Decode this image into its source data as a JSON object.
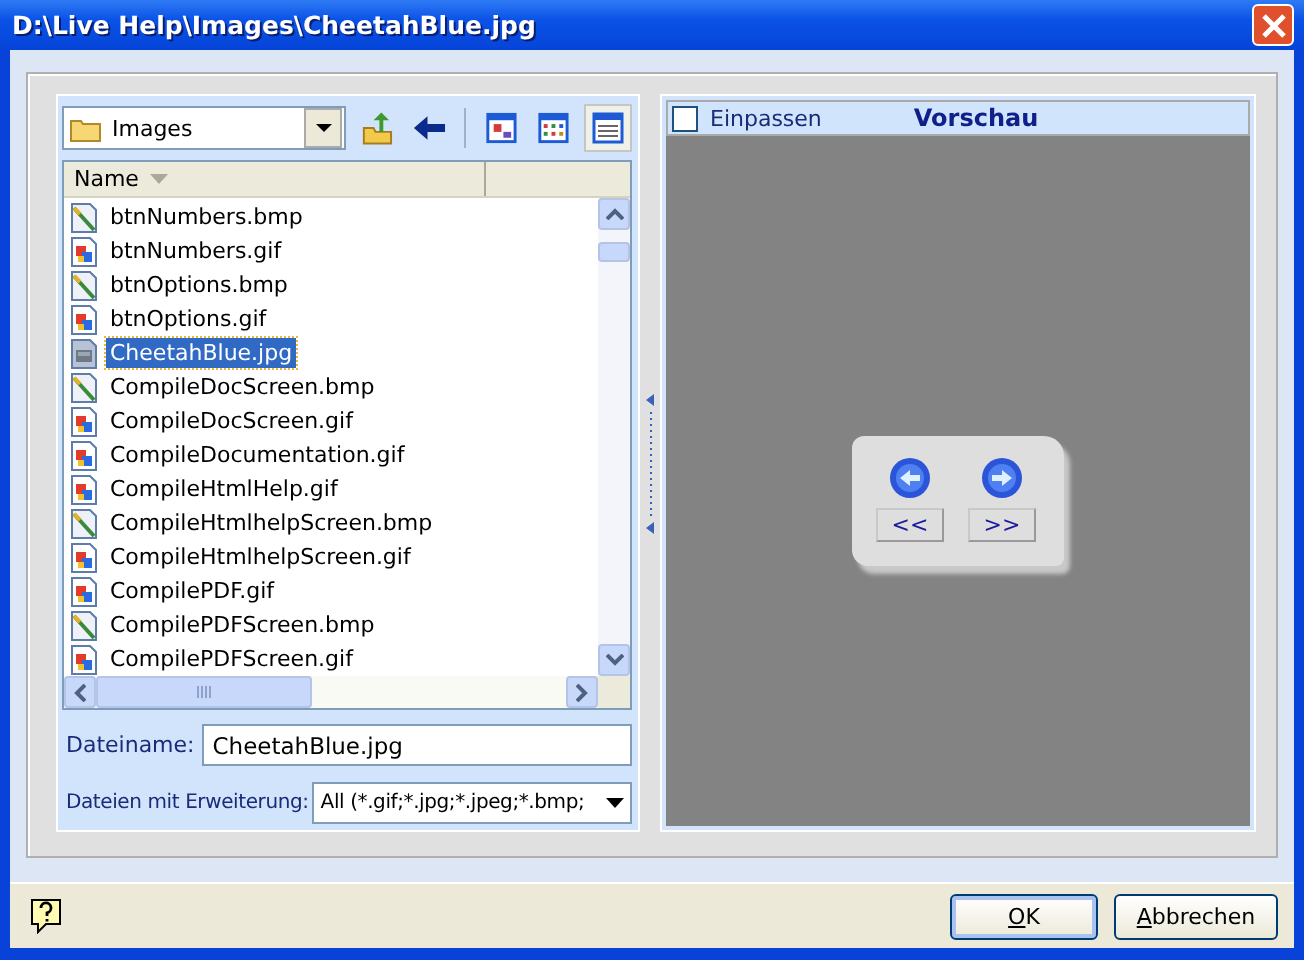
{
  "window": {
    "title": "D:\\Live Help\\Images\\CheetahBlue.jpg"
  },
  "folder_combo": {
    "value": "Images"
  },
  "file_list": {
    "columns": [
      "Name"
    ],
    "rows": [
      {
        "name": "btnNumbers.bmp",
        "kind": "bmp",
        "selected": false
      },
      {
        "name": "btnNumbers.gif",
        "kind": "gif",
        "selected": false
      },
      {
        "name": "btnOptions.bmp",
        "kind": "bmp",
        "selected": false
      },
      {
        "name": "btnOptions.gif",
        "kind": "gif",
        "selected": false
      },
      {
        "name": "CheetahBlue.jpg",
        "kind": "jpg",
        "selected": true
      },
      {
        "name": "CompileDocScreen.bmp",
        "kind": "bmp",
        "selected": false
      },
      {
        "name": "CompileDocScreen.gif",
        "kind": "gif",
        "selected": false
      },
      {
        "name": "CompileDocumentation.gif",
        "kind": "gif",
        "selected": false
      },
      {
        "name": "CompileHtmlHelp.gif",
        "kind": "gif",
        "selected": false
      },
      {
        "name": "CompileHtmlhelpScreen.bmp",
        "kind": "bmp",
        "selected": false
      },
      {
        "name": "CompileHtmlhelpScreen.gif",
        "kind": "gif",
        "selected": false
      },
      {
        "name": "CompilePDF.gif",
        "kind": "gif",
        "selected": false
      },
      {
        "name": "CompilePDFScreen.bmp",
        "kind": "bmp",
        "selected": false
      },
      {
        "name": "CompilePDFScreen.gif",
        "kind": "gif",
        "selected": false
      }
    ]
  },
  "filename": {
    "label": "Dateiname:",
    "value": "CheetahBlue.jpg"
  },
  "filter": {
    "label": "Dateien mit Erweiterung:",
    "value": "All (*.gif;*.jpg;*.jpeg;*.bmp;"
  },
  "preview": {
    "fit_label": "Einpassen",
    "fit_checked": false,
    "title": "Vorschau",
    "image_buttons": [
      "<<",
      ">>"
    ]
  },
  "buttons": [
    {
      "label": "OK",
      "default": true
    },
    {
      "label": "Abbrechen",
      "default": false
    }
  ]
}
